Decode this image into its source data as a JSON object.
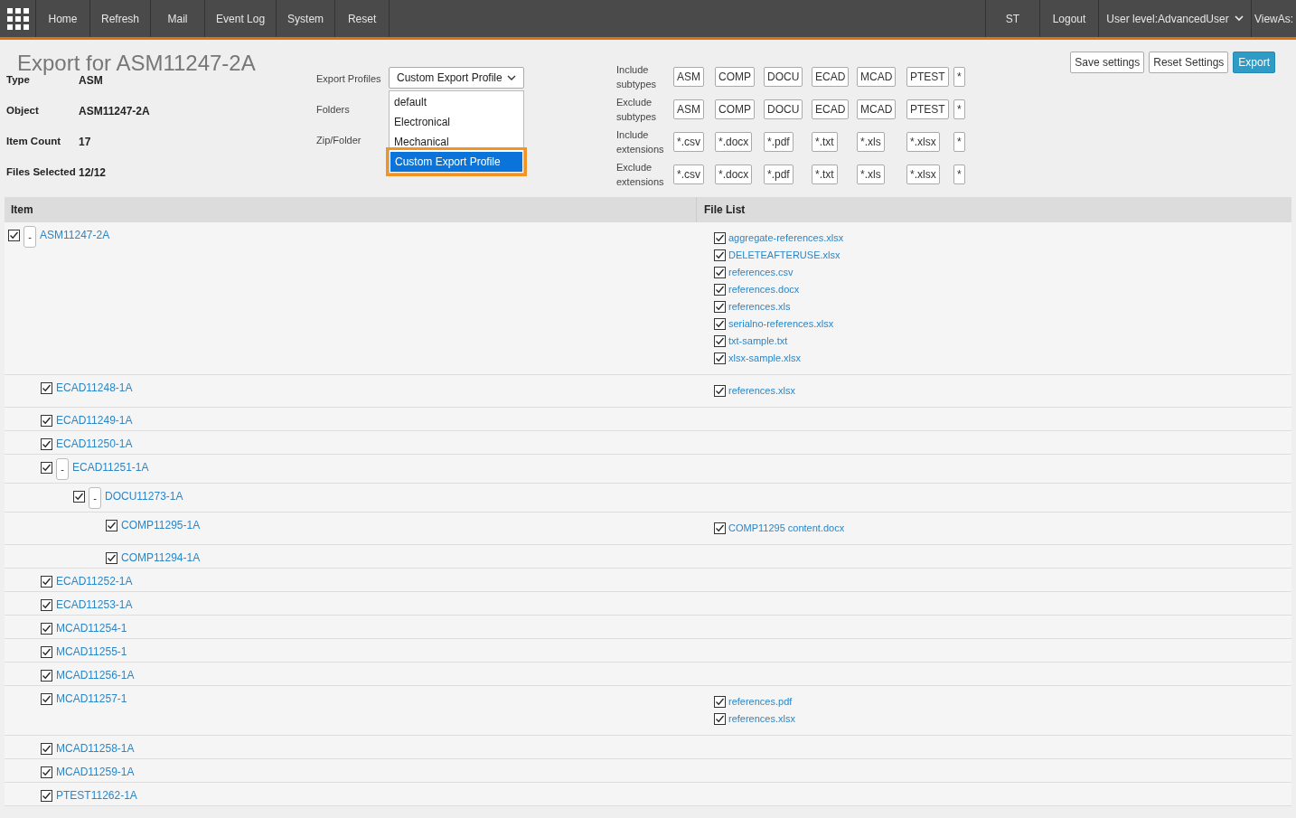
{
  "nav": {
    "left": [
      "Home",
      "Refresh",
      "Mail",
      "Event Log",
      "System",
      "Reset"
    ],
    "right": [
      {
        "label": "ST",
        "kind": "link"
      },
      {
        "label": "Logout",
        "kind": "link"
      },
      {
        "label": "User level:AdvancedUser",
        "kind": "dropdown"
      },
      {
        "label": "ViewAs:",
        "kind": "link"
      }
    ]
  },
  "title": "Export for ASM11247-2A",
  "actions": [
    {
      "label": "Save settings",
      "primary": false
    },
    {
      "label": "Reset Settings",
      "primary": false
    },
    {
      "label": "Export",
      "primary": true
    }
  ],
  "info": [
    {
      "label": "Type",
      "value": "ASM"
    },
    {
      "label": "Object",
      "value": "ASM11247-2A"
    },
    {
      "label": "Item Count",
      "value": "17"
    },
    {
      "label": "Files Selected",
      "value": "12/12"
    }
  ],
  "options": {
    "labels": [
      "Export Profiles",
      "Folders",
      "Zip/Folder"
    ],
    "profile": {
      "value": "Custom Export Profile",
      "expanded": true,
      "items": [
        {
          "label": "default",
          "selected": false
        },
        {
          "label": "Electronical",
          "selected": false
        },
        {
          "label": "Mechanical",
          "selected": false
        },
        {
          "label": "Custom Export Profile",
          "selected": true
        }
      ]
    }
  },
  "filters": [
    {
      "label": "Include subtypes",
      "values": [
        "ASM",
        "COMP",
        "DOCU",
        "ECAD",
        "MCAD",
        "PTEST",
        "*"
      ]
    },
    {
      "label": "Exclude subtypes",
      "values": [
        "ASM",
        "COMP",
        "DOCU",
        "ECAD",
        "MCAD",
        "PTEST",
        "*"
      ]
    },
    {
      "label": "Include extensions",
      "values": [
        "*.csv",
        "*.docx",
        "*.pdf",
        "*.txt",
        "*.xls",
        "*.xlsx",
        "*"
      ]
    },
    {
      "label": "Exclude extensions",
      "values": [
        "*.csv",
        "*.docx",
        "*.pdf",
        "*.txt",
        "*.xls",
        "*.xlsx",
        "*"
      ]
    }
  ],
  "table": {
    "columns": [
      "Item",
      "File List"
    ],
    "tree": [
      {
        "label": "ASM11247-2A",
        "checked": true,
        "toggle": "-",
        "files": [
          {
            "name": "aggregate-references.xlsx",
            "checked": true
          },
          {
            "name": "DELETEAFTERUSE.xlsx",
            "checked": true
          },
          {
            "name": "references.csv",
            "checked": true
          },
          {
            "name": "references.docx",
            "checked": true
          },
          {
            "name": "references.xls",
            "checked": true
          },
          {
            "name": "serialno-references.xlsx",
            "checked": true
          },
          {
            "name": "txt-sample.txt",
            "checked": true
          },
          {
            "name": "xlsx-sample.xlsx",
            "checked": true
          }
        ],
        "children": [
          {
            "label": "ECAD11248-1A",
            "checked": true,
            "files": [
              {
                "name": "references.xlsx",
                "checked": true
              }
            ]
          },
          {
            "label": "ECAD11249-1A",
            "checked": true
          },
          {
            "label": "ECAD11250-1A",
            "checked": true
          },
          {
            "label": "ECAD11251-1A",
            "checked": true,
            "toggle": "-",
            "children": [
              {
                "label": "DOCU11273-1A",
                "checked": true,
                "toggle": "-",
                "children": [
                  {
                    "label": "COMP11295-1A",
                    "checked": true,
                    "files": [
                      {
                        "name": "COMP11295 content.docx",
                        "checked": true
                      }
                    ]
                  },
                  {
                    "label": "COMP11294-1A",
                    "checked": true
                  }
                ]
              }
            ]
          },
          {
            "label": "ECAD11252-1A",
            "checked": true
          },
          {
            "label": "ECAD11253-1A",
            "checked": true
          },
          {
            "label": "MCAD11254-1",
            "checked": true
          },
          {
            "label": "MCAD11255-1",
            "checked": true
          },
          {
            "label": "MCAD11256-1A",
            "checked": true
          },
          {
            "label": "MCAD11257-1",
            "checked": true,
            "files": [
              {
                "name": "references.pdf",
                "checked": true
              },
              {
                "name": "references.xlsx",
                "checked": true
              }
            ]
          },
          {
            "label": "MCAD11258-1A",
            "checked": true
          },
          {
            "label": "MCAD11259-1A",
            "checked": true
          },
          {
            "label": "PTEST11262-1A",
            "checked": true
          }
        ]
      }
    ]
  }
}
